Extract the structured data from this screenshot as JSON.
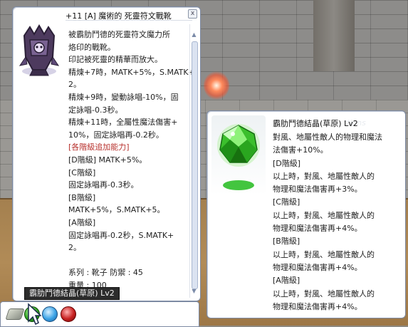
{
  "item_tooltip": {
    "title": "+11 [A] 魔術的 死靈符文戰靴",
    "description_lines": [
      {
        "text": "被霸肋鬥德的死靈符文魔力所",
        "red": false
      },
      {
        "text": "烙印的戰靴。",
        "red": false
      },
      {
        "text": "印記被死靈的精華而放大。",
        "red": false
      },
      {
        "text": "精煉+7時，MATK+5%，S.MATK+",
        "red": false
      },
      {
        "text": "2。",
        "red": false
      },
      {
        "text": "精煉+9時，變動詠唱-10%，固",
        "red": false
      },
      {
        "text": "定詠唱-0.3秒。",
        "red": false
      },
      {
        "text": "精煉+11時，全屬性魔法傷害+",
        "red": false
      },
      {
        "text": "10%，固定詠唱再-0.2秒。",
        "red": false
      },
      {
        "text": "[各階級追加能力]",
        "red": true
      },
      {
        "text": "[D階級] MATK+5%。",
        "red": false
      },
      {
        "text": "[C階級]",
        "red": false
      },
      {
        "text": " 固定詠唱再-0.3秒。",
        "red": false
      },
      {
        "text": "[B階級]",
        "red": false
      },
      {
        "text": " MATK+5%，S.MATK+5。",
        "red": false
      },
      {
        "text": "[A階級]",
        "red": false
      },
      {
        "text": " 固定詠唱再-0.2秒，S.MATK+",
        "red": false
      },
      {
        "text": "2。",
        "red": false
      }
    ],
    "stats_line": "系列 : 靴子  防禦 : 45",
    "weight_line": "重量 : 100",
    "close_label": "x",
    "scroll_up": "▲",
    "scroll_down": "▼"
  },
  "card_tooltip": {
    "title": "霸肋鬥德結晶(草原) Lv2",
    "ghost_text": "ctions",
    "description_lines": [
      "對風、地屬性敵人的物理和魔法",
      "法傷害+10%。",
      "[D階級]",
      "以上時，對風、地屬性敵人的",
      "物理和魔法傷害再+3%。",
      "[C階級]",
      "以上時，對風、地屬性敵人的",
      "物理和魔法傷害再+4%。",
      "[B階級]",
      "以上時，對風、地屬性敵人的",
      "物理和魔法傷害再+4%。",
      "[A階級]",
      "以上時，對風、地屬性敵人的",
      "物理和魔法傷害再+4%。"
    ]
  },
  "hover_tooltip": "霸肋鬥德結晶(草原) Lv2",
  "colors": {
    "accent_red": "#b8322e",
    "gem_green": "#2fa31f"
  }
}
